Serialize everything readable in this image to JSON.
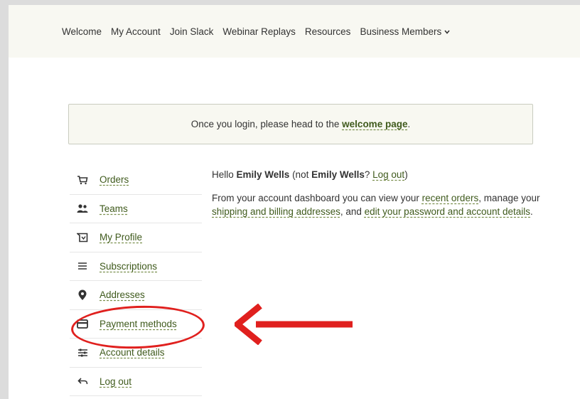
{
  "nav": {
    "items": [
      "Welcome",
      "My Account",
      "Join Slack",
      "Webinar Replays",
      "Resources"
    ],
    "dropdown_label": "Business Members"
  },
  "notice": {
    "prefix": "Once you login, please head to the ",
    "link": "welcome page",
    "suffix": "."
  },
  "sidebar": {
    "items": [
      {
        "label": "Orders",
        "icon": "cart-icon"
      },
      {
        "label": "Teams",
        "icon": "users-icon"
      },
      {
        "label": "My Profile",
        "icon": "profile-icon"
      },
      {
        "label": "Subscriptions",
        "icon": "list-icon"
      },
      {
        "label": "Addresses",
        "icon": "location-pin-icon"
      },
      {
        "label": "Payment methods",
        "icon": "credit-card-icon"
      },
      {
        "label": "Account details",
        "icon": "sliders-icon"
      },
      {
        "label": "Log out",
        "icon": "logout-arrow-icon"
      }
    ]
  },
  "content": {
    "hello": "Hello ",
    "user_name": "Emily Wells",
    "not_prefix": " (not ",
    "not_name": "Emily Wells",
    "not_q": "? ",
    "logout_link": "Log out",
    "close_paren": ")",
    "dash_1": "From your account dashboard you can view your ",
    "recent_orders": "recent orders",
    "dash_2": ", manage your ",
    "addresses_link": "shipping and billing addresses",
    "dash_3": ", and ",
    "edit_link": "edit your password and account details",
    "dash_4": "."
  },
  "colors": {
    "accent_link": "#3f5a1c",
    "annotation_red": "#e0201e",
    "nav_bg": "#f8f8f2"
  }
}
